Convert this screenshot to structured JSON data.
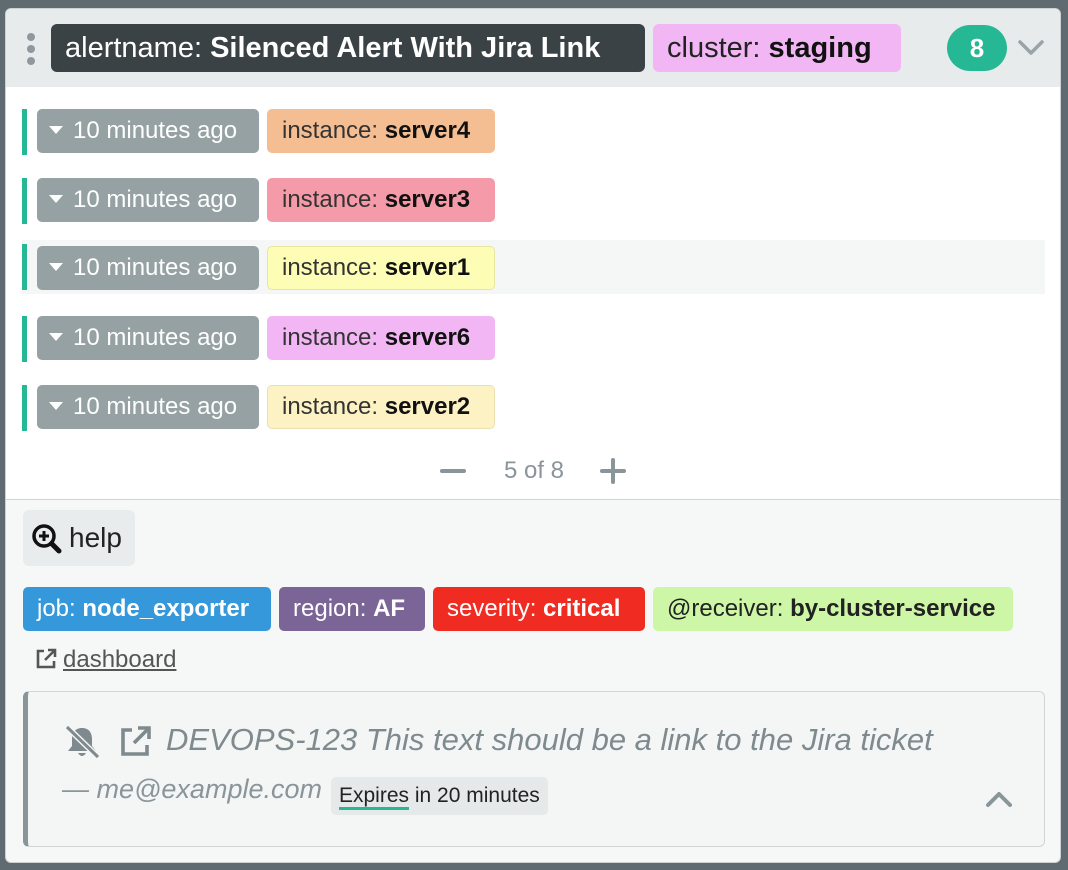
{
  "header": {
    "alertname_key": "alertname:",
    "alertname_value": "Silenced Alert With Jira Link",
    "cluster_key": "cluster:",
    "cluster_value": "staging",
    "count": "8"
  },
  "alerts": [
    {
      "time": "10 minutes ago",
      "label_key": "instance:",
      "label_value": "server4",
      "color": "#f5be92"
    },
    {
      "time": "10 minutes ago",
      "label_key": "instance:",
      "label_value": "server3",
      "color": "#f49aa8"
    },
    {
      "time": "10 minutes ago",
      "label_key": "instance:",
      "label_value": "server1",
      "color": "#fdfdb5"
    },
    {
      "time": "10 minutes ago",
      "label_key": "instance:",
      "label_value": "server6",
      "color": "#f1b6f3"
    },
    {
      "time": "10 minutes ago",
      "label_key": "instance:",
      "label_value": "server2",
      "color": "#fdf2c4"
    }
  ],
  "pager": {
    "text": "5 of 8"
  },
  "annotations": {
    "help_label": "help",
    "dashboard_link": "dashboard"
  },
  "labels": [
    {
      "key": "job:",
      "value": "node_exporter",
      "color": "#3498db"
    },
    {
      "key": "region:",
      "value": "AF",
      "color": "#7b6496"
    },
    {
      "key": "severity:",
      "value": "critical",
      "color": "#f02b22"
    },
    {
      "key": "@receiver:",
      "value": "by-cluster-service",
      "color": "#cdf6a6"
    }
  ],
  "silence": {
    "comment": "DEVOPS-123 This text should be a link to the Jira ticket",
    "author": "— me@example.com",
    "expires_word": "Expires",
    "expires_rest": " in 20 minutes"
  },
  "colors": {
    "accent": "#26b894",
    "header_dark": "#3b4245",
    "time_button": "#95a1a3"
  }
}
